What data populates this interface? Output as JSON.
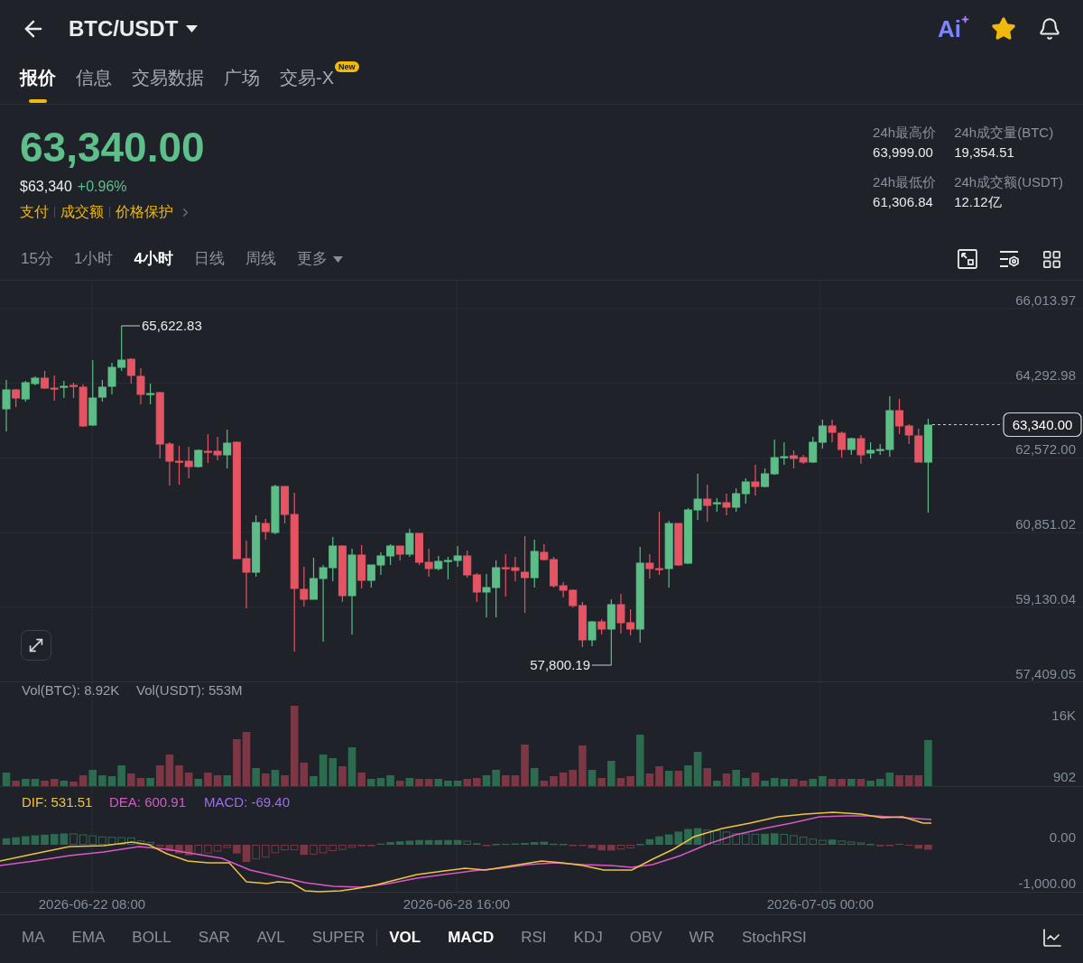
{
  "header": {
    "title": "BTC/USDT",
    "ai_label": "Ai",
    "favorite": true
  },
  "tabs": [
    {
      "label": "报价",
      "selected": true
    },
    {
      "label": "信息",
      "selected": false
    },
    {
      "label": "交易数据",
      "selected": false
    },
    {
      "label": "广场",
      "selected": false
    },
    {
      "label": "交易-X",
      "selected": false,
      "badge": "New"
    }
  ],
  "quote": {
    "last_price": "63,340.00",
    "fiat_price": "$63,340",
    "change": "+0.96%",
    "links": [
      "支付",
      "成交额",
      "价格保护"
    ]
  },
  "stats": [
    {
      "label": "24h最高价",
      "value": "63,999.00"
    },
    {
      "label": "24h成交量(BTC)",
      "value": "19,354.51"
    },
    {
      "label": "24h最低价",
      "value": "61,306.84"
    },
    {
      "label": "24h成交额(USDT)",
      "value": "12.12亿"
    }
  ],
  "intervals": [
    {
      "label": "15分",
      "selected": false,
      "kind": "option"
    },
    {
      "label": "1小时",
      "selected": false,
      "kind": "option"
    },
    {
      "label": "4小时",
      "selected": true,
      "kind": "option"
    },
    {
      "label": "日线",
      "selected": false,
      "kind": "option"
    },
    {
      "label": "周线",
      "selected": false,
      "kind": "option"
    },
    {
      "label": "更多",
      "selected": false,
      "kind": "dropdown"
    }
  ],
  "price_chart": {
    "axis_labels": [
      "66,013.97",
      "64,292.98",
      "62,572.00",
      "60,851.02",
      "59,130.04",
      "57,409.05"
    ],
    "high_label": "65,622.83",
    "low_label": "57,800.19",
    "last_price_label": "63,340.00"
  },
  "volume": {
    "legend": [
      "Vol(BTC): 8.92K",
      "Vol(USDT): 553M"
    ],
    "axis_labels": [
      "16K",
      "902"
    ]
  },
  "macd": {
    "legend": [
      {
        "text": "DIF: 531.51",
        "color": "#f0c244"
      },
      {
        "text": "DEA: 600.91",
        "color": "#d958c6"
      },
      {
        "text": "MACD: -69.40",
        "color": "#9d6ee8"
      }
    ],
    "axis_labels": [
      "0.00",
      "-1,000.00"
    ]
  },
  "time_axis": [
    "2026-06-22 08:00",
    "2026-06-28 16:00",
    "2026-07-05 00:00"
  ],
  "main_indicators": [
    {
      "label": "MA",
      "selected": false
    },
    {
      "label": "EMA",
      "selected": false
    },
    {
      "label": "BOLL",
      "selected": false
    },
    {
      "label": "SAR",
      "selected": false
    },
    {
      "label": "AVL",
      "selected": false
    },
    {
      "label": "SUPER",
      "selected": false
    }
  ],
  "sub_indicators": [
    {
      "label": "VOL",
      "selected": true
    },
    {
      "label": "MACD",
      "selected": true
    },
    {
      "label": "RSI",
      "selected": false
    },
    {
      "label": "KDJ",
      "selected": false
    },
    {
      "label": "OBV",
      "selected": false
    },
    {
      "label": "WR",
      "selected": false
    },
    {
      "label": "StochRSI",
      "selected": false
    }
  ]
}
